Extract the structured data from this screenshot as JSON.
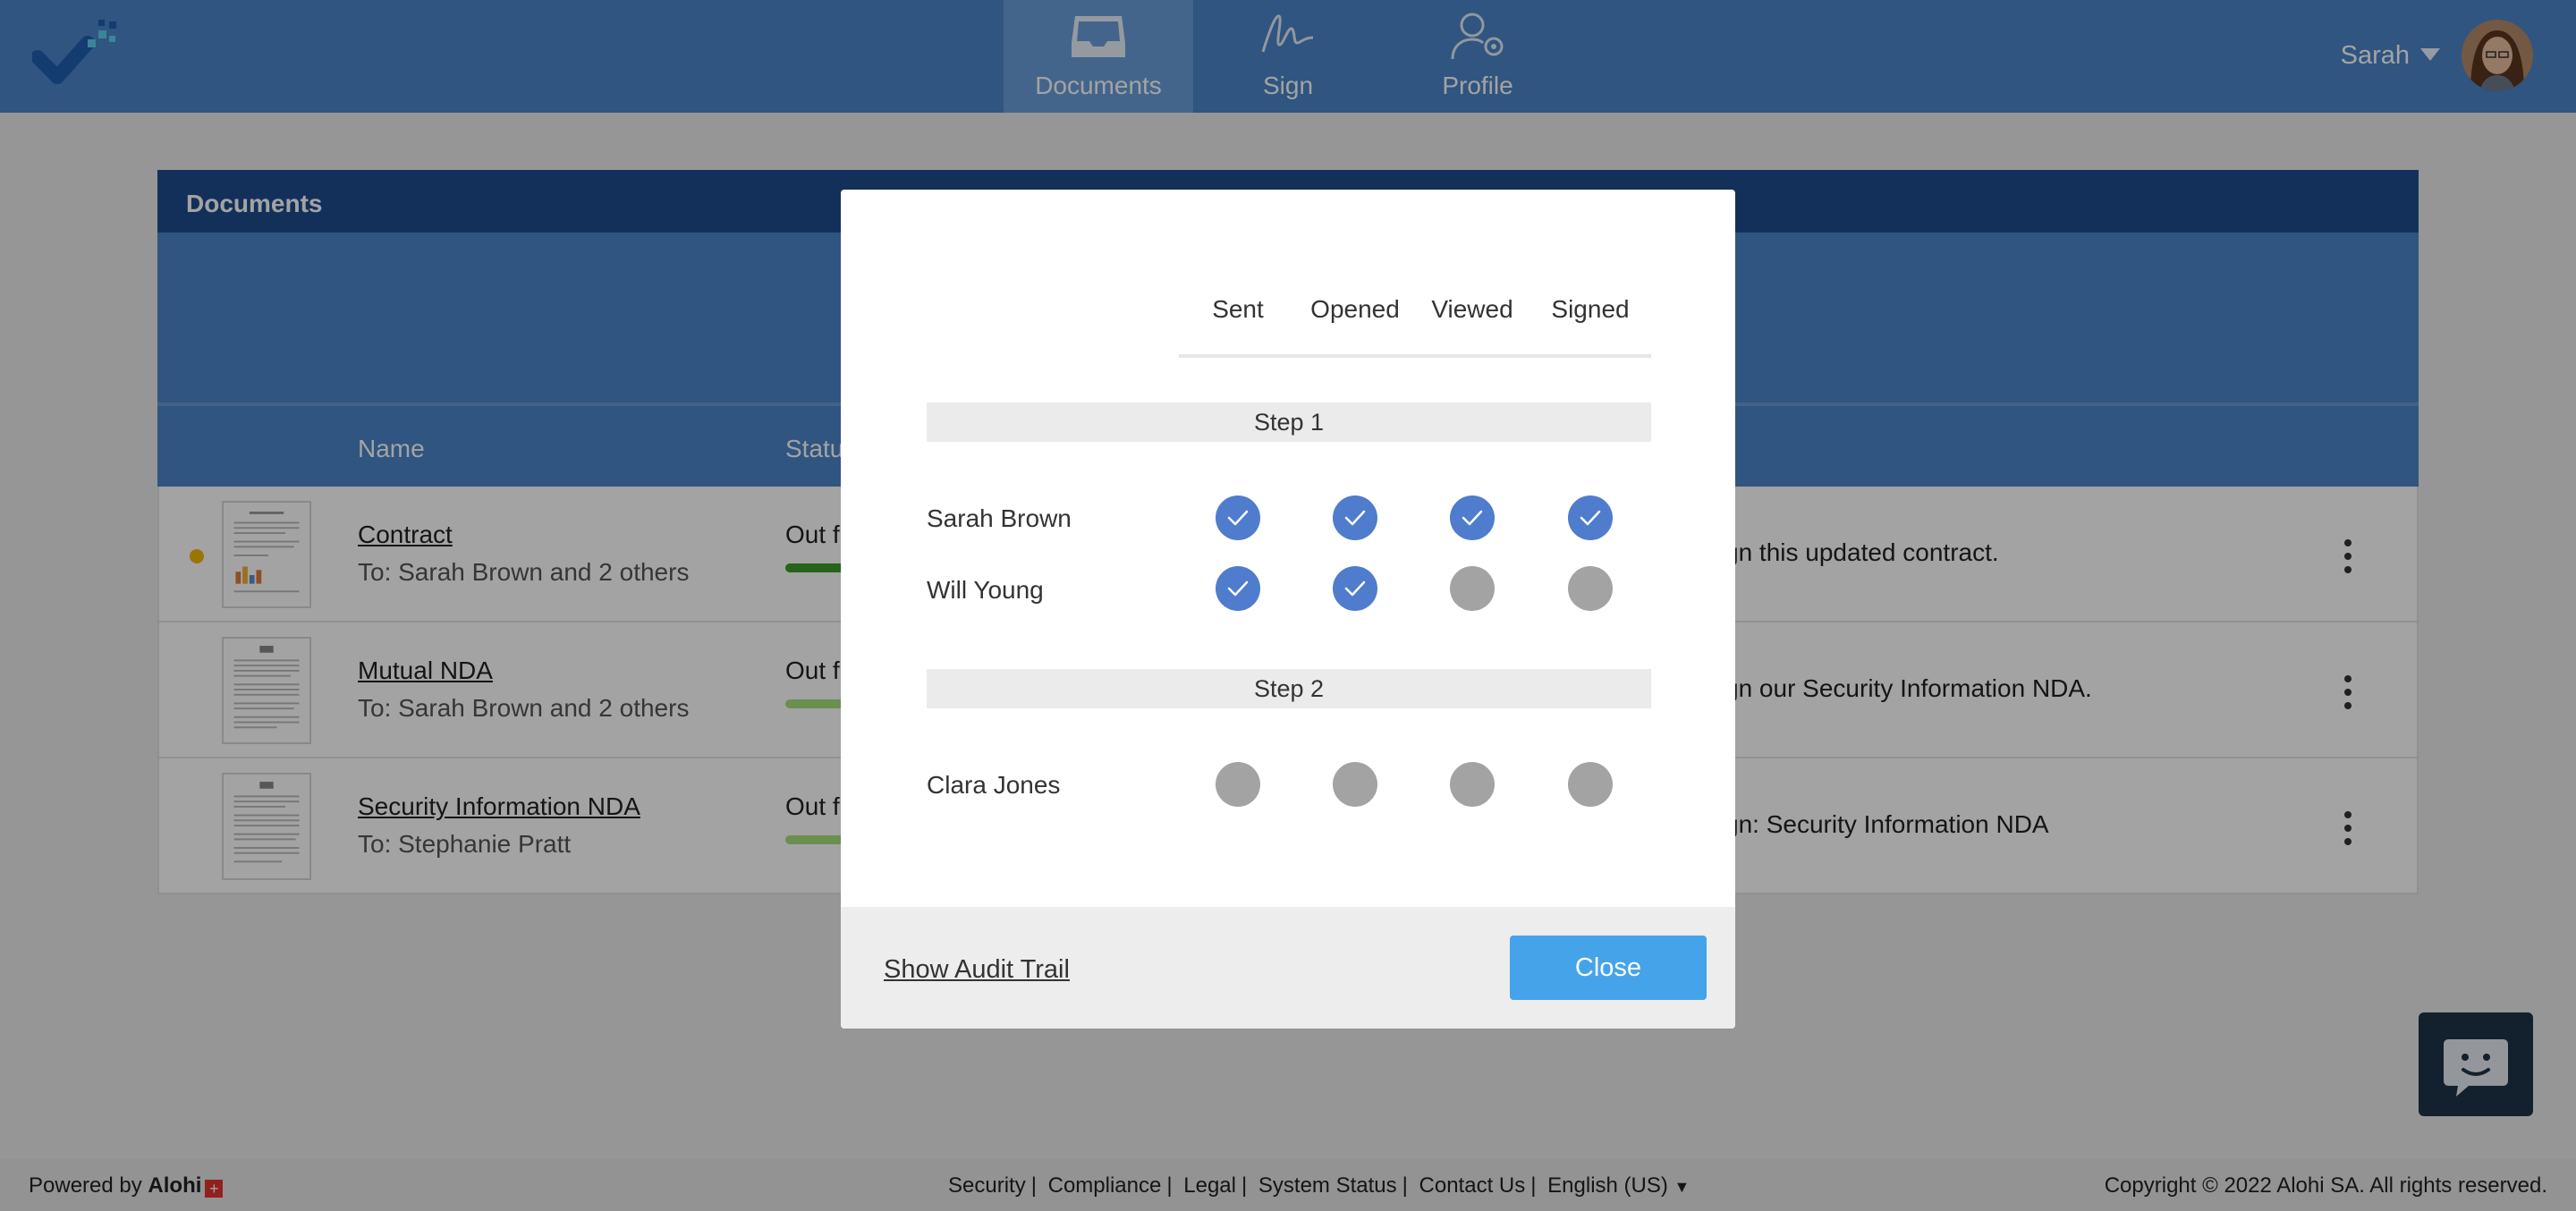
{
  "nav": {
    "logo_icon": "checkmark-logo-icon",
    "tabs": [
      {
        "label": "Documents",
        "icon": "inbox-tray-icon",
        "active": true
      },
      {
        "label": "Sign",
        "icon": "signature-icon",
        "active": false
      },
      {
        "label": "Profile",
        "icon": "user-gear-icon",
        "active": false
      }
    ],
    "user": {
      "name": "Sarah",
      "icon": "caret-down-icon"
    }
  },
  "documents": {
    "title": "Documents",
    "columns": {
      "name": "Name",
      "status": "Status"
    },
    "rows": [
      {
        "title": "Contract",
        "to": "To: Sarah Brown and 2 others",
        "status": "Out f",
        "progress": 0.5,
        "message": "gn this updated contract.",
        "unread": true
      },
      {
        "title": "Mutual NDA",
        "to": "To: Sarah Brown and 2 others",
        "status": "Out f",
        "progress": 0.0,
        "message": "gn our Security Information NDA.",
        "unread": false
      },
      {
        "title": "Security Information NDA",
        "to": "To: Stephanie Pratt",
        "status": "Out f",
        "progress": 0.0,
        "message": "gn: Security Information NDA",
        "unread": false
      }
    ]
  },
  "modal": {
    "columns": [
      "Sent",
      "Opened",
      "Viewed",
      "Signed"
    ],
    "steps": [
      {
        "label": "Step 1",
        "people": [
          {
            "name": "Sarah Brown",
            "status": [
              true,
              true,
              true,
              true
            ]
          },
          {
            "name": "Will Young",
            "status": [
              true,
              true,
              false,
              false
            ]
          }
        ]
      },
      {
        "label": "Step 2",
        "people": [
          {
            "name": "Clara Jones",
            "status": [
              false,
              false,
              false,
              false
            ]
          }
        ]
      }
    ],
    "audit_link": "Show Audit Trail",
    "close_label": "Close"
  },
  "footer": {
    "powered_by": "Powered by",
    "brand": "Alohi",
    "links": [
      "Security",
      "Compliance",
      "Legal",
      "System Status",
      "Contact Us",
      "English (US)"
    ],
    "copyright": "Copyright © 2022 Alohi SA. All rights reserved."
  },
  "colors": {
    "nav_bg": "#4a86c9",
    "card_header": "#1e4c8f",
    "check_done": "#4f7ccc",
    "check_pending": "#a3a3a3",
    "close_button": "#45a3ea",
    "unread_dot": "#f2b705"
  }
}
